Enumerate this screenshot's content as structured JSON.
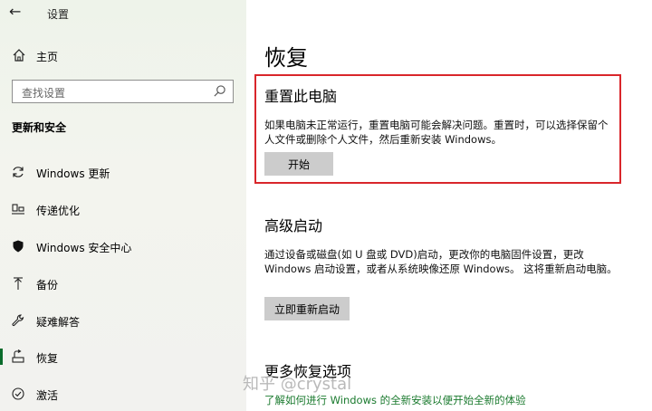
{
  "window": {
    "title": "设置",
    "back_icon": "back-arrow-icon"
  },
  "sidebar": {
    "home_label": "主页",
    "search_placeholder": "查找设置",
    "section_title": "更新和安全",
    "items": [
      {
        "label": "Windows 更新",
        "icon": "sync-icon"
      },
      {
        "label": "传递优化",
        "icon": "delivery-optimization-icon"
      },
      {
        "label": "Windows 安全中心",
        "icon": "shield-icon"
      },
      {
        "label": "备份",
        "icon": "backup-arrow-icon"
      },
      {
        "label": "疑难解答",
        "icon": "wrench-icon"
      },
      {
        "label": "恢复",
        "icon": "recovery-icon",
        "active": true
      },
      {
        "label": "激活",
        "icon": "check-circle-icon"
      }
    ],
    "active_color": "#0a6b2b"
  },
  "main": {
    "title": "恢复",
    "reset": {
      "heading": "重置此电脑",
      "description": "如果电脑未正常运行，重置电脑可能会解决问题。重置时，可以选择保留个人文件或删除个人文件，然后重新安装 Windows。",
      "button": "开始",
      "highlight_color": "#d9262b"
    },
    "advanced": {
      "heading": "高级启动",
      "description": "通过设备或磁盘(如 U 盘或 DVD)启动，更改你的电脑固件设置，更改 Windows 启动设置，或者从系统映像还原 Windows。 这将重新启动电脑。",
      "button": "立即重新启动"
    },
    "more": {
      "heading": "更多恢复选项",
      "link": "了解如何进行 Windows 的全新安装以便开始全新的体验"
    }
  },
  "watermark": "知乎 @crystal"
}
